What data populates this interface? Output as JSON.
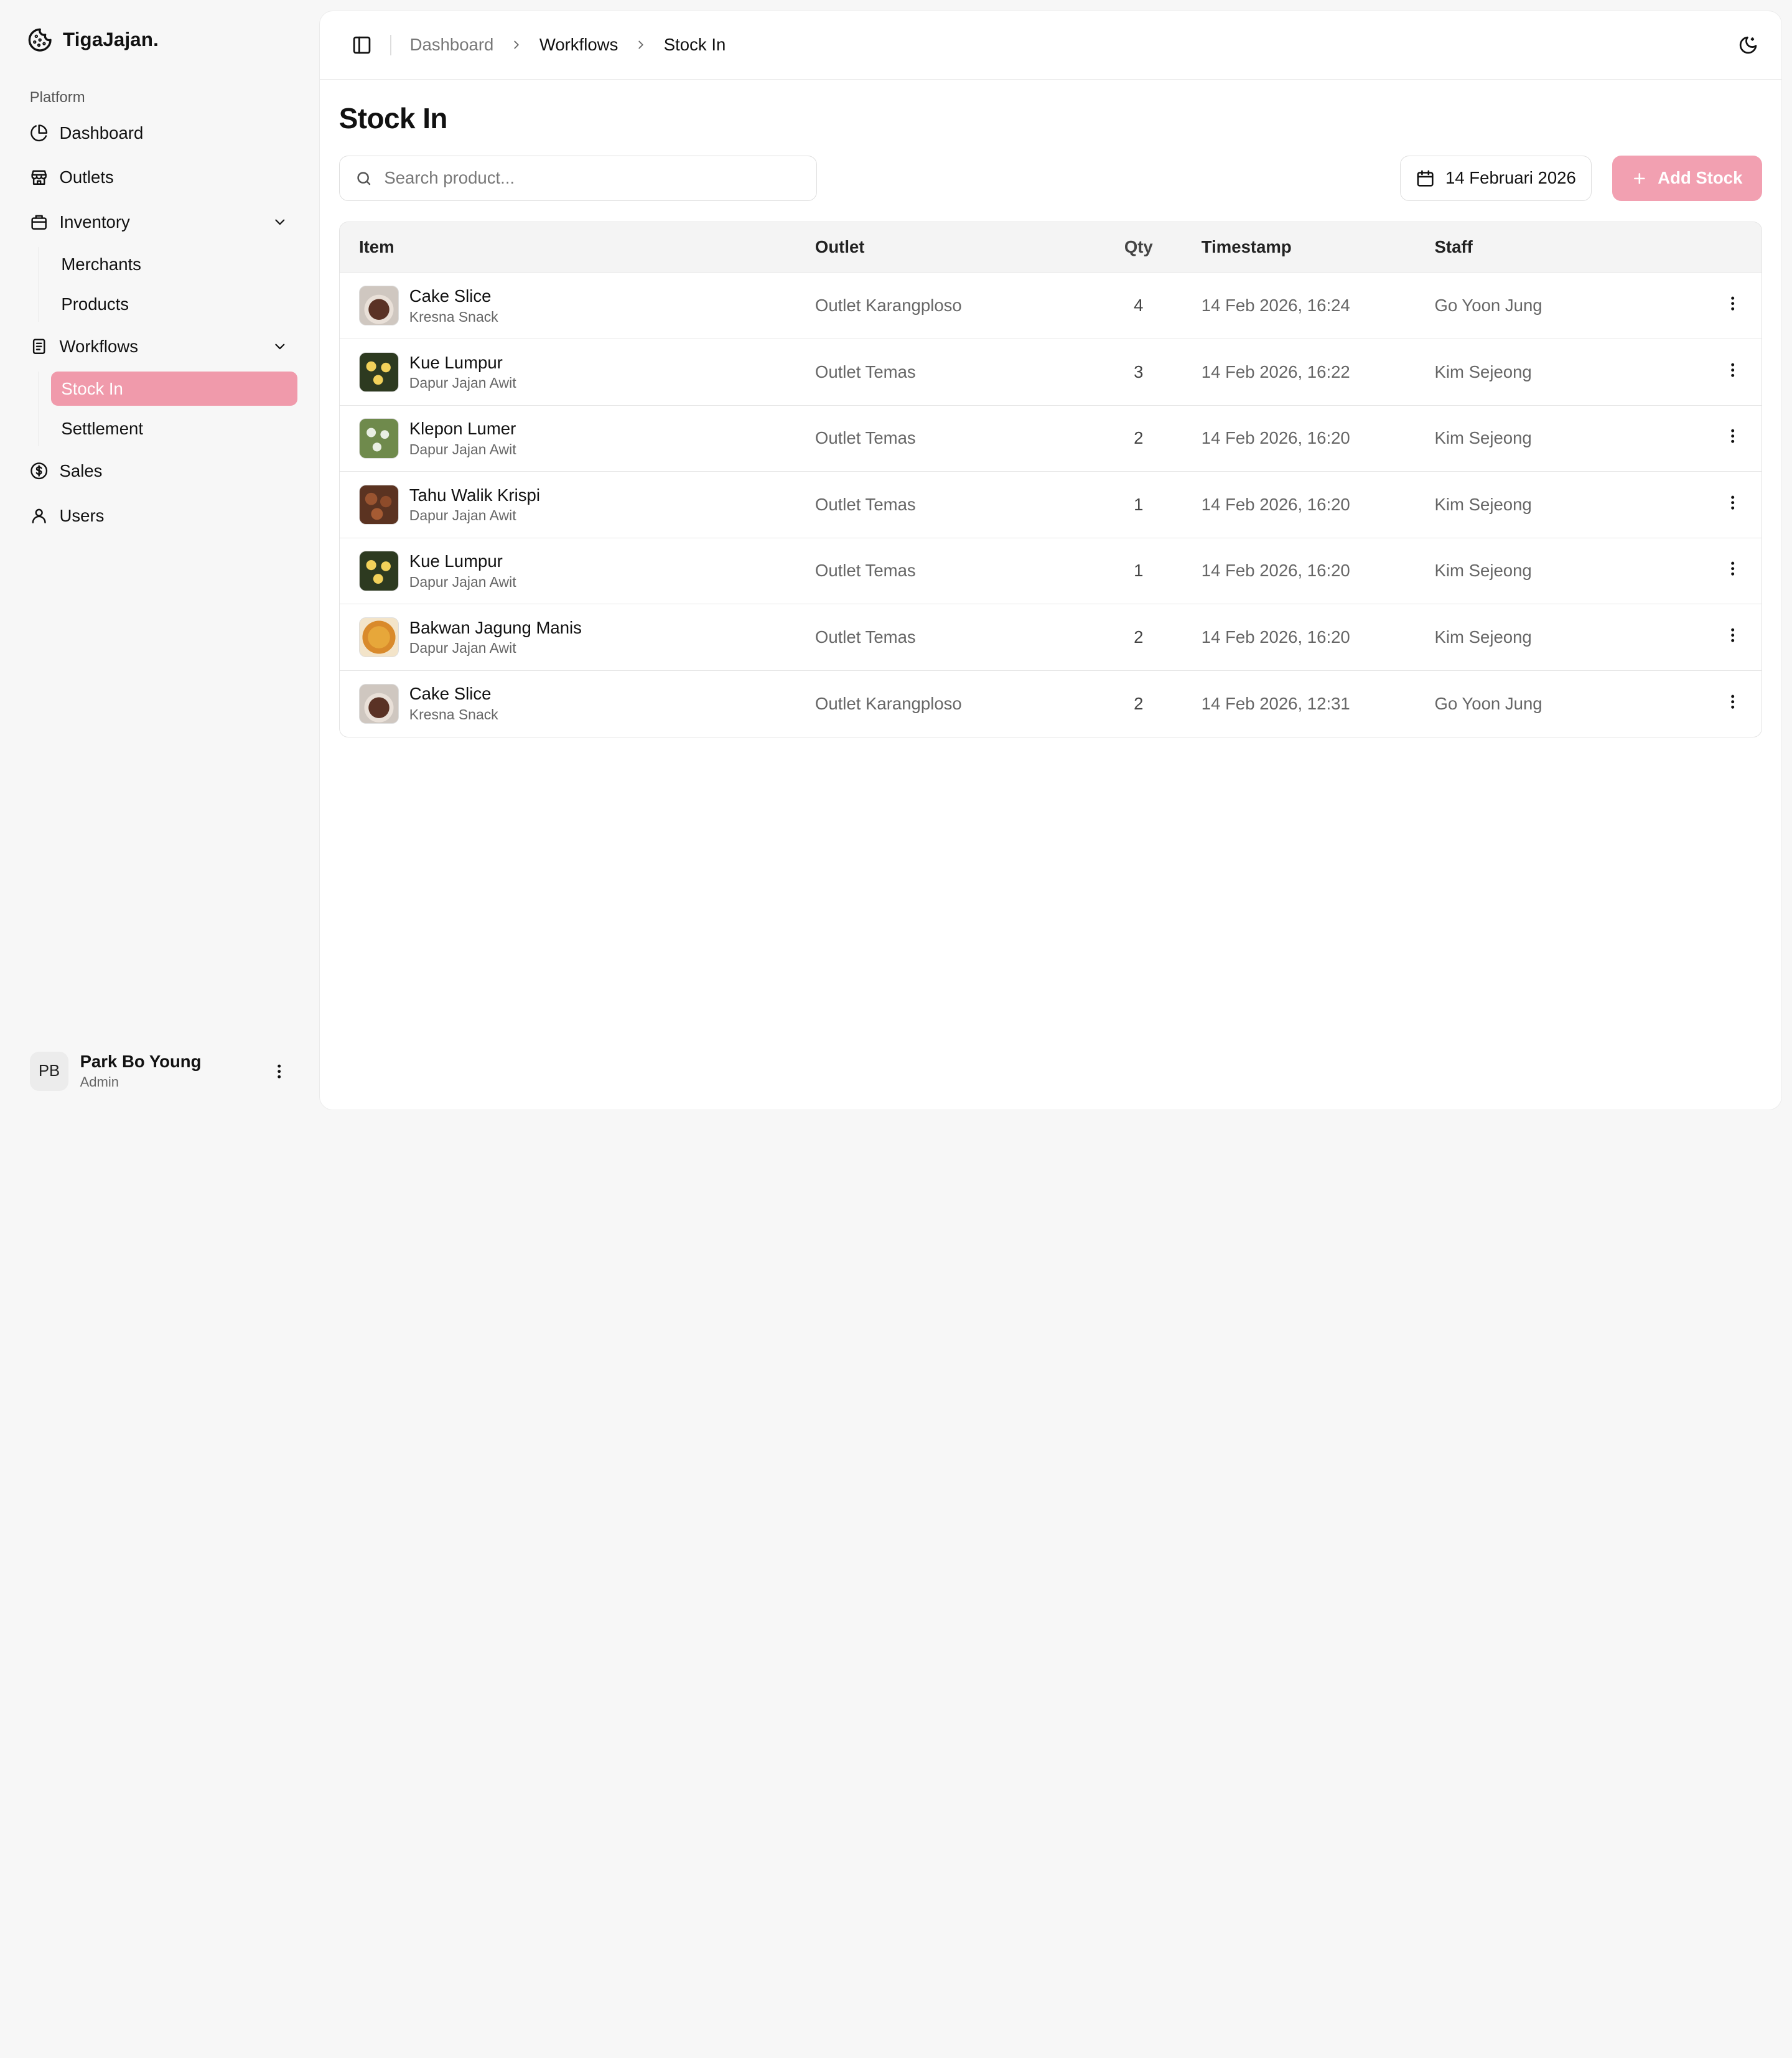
{
  "brand": {
    "name": "TigaJajan."
  },
  "sidebar": {
    "section_label": "Platform",
    "items": {
      "dashboard": "Dashboard",
      "outlets": "Outlets",
      "inventory": "Inventory",
      "merchants": "Merchants",
      "products": "Products",
      "workflows": "Workflows",
      "stock_in": "Stock In",
      "settlement": "Settlement",
      "sales": "Sales",
      "users": "Users"
    },
    "active_item": "Stock In",
    "accent_color": "#f09aab"
  },
  "user": {
    "initials": "PB",
    "name": "Park Bo Young",
    "role": "Admin"
  },
  "breadcrumb": {
    "items": [
      "Dashboard",
      "Workflows",
      "Stock In"
    ]
  },
  "page": {
    "title": "Stock In",
    "search_placeholder": "Search product...",
    "date_label": "14 Februari 2026",
    "add_button_label": "Add Stock"
  },
  "table": {
    "columns": {
      "item": "Item",
      "outlet": "Outlet",
      "qty": "Qty",
      "timestamp": "Timestamp",
      "staff": "Staff"
    },
    "rows": [
      {
        "name": "Cake Slice",
        "merchant": "Kresna Snack",
        "outlet": "Outlet Karangploso",
        "qty": "4",
        "timestamp": "14 Feb 2026, 16:24",
        "staff": "Go Yoon Jung",
        "thumb": "cake"
      },
      {
        "name": "Kue Lumpur",
        "merchant": "Dapur Jajan Awit",
        "outlet": "Outlet Temas",
        "qty": "3",
        "timestamp": "14 Feb 2026, 16:22",
        "staff": "Kim Sejeong",
        "thumb": "lumpur"
      },
      {
        "name": "Klepon Lumer",
        "merchant": "Dapur Jajan Awit",
        "outlet": "Outlet Temas",
        "qty": "2",
        "timestamp": "14 Feb 2026, 16:20",
        "staff": "Kim Sejeong",
        "thumb": "klepon"
      },
      {
        "name": "Tahu Walik Krispi",
        "merchant": "Dapur Jajan Awit",
        "outlet": "Outlet Temas",
        "qty": "1",
        "timestamp": "14 Feb 2026, 16:20",
        "staff": "Kim Sejeong",
        "thumb": "tahu"
      },
      {
        "name": "Kue Lumpur",
        "merchant": "Dapur Jajan Awit",
        "outlet": "Outlet Temas",
        "qty": "1",
        "timestamp": "14 Feb 2026, 16:20",
        "staff": "Kim Sejeong",
        "thumb": "lumpur"
      },
      {
        "name": "Bakwan Jagung Manis",
        "merchant": "Dapur Jajan Awit",
        "outlet": "Outlet Temas",
        "qty": "2",
        "timestamp": "14 Feb 2026, 16:20",
        "staff": "Kim Sejeong",
        "thumb": "bakwan"
      },
      {
        "name": "Cake Slice",
        "merchant": "Kresna Snack",
        "outlet": "Outlet Karangploso",
        "qty": "2",
        "timestamp": "14 Feb 2026, 12:31",
        "staff": "Go Yoon Jung",
        "thumb": "cake"
      }
    ]
  }
}
